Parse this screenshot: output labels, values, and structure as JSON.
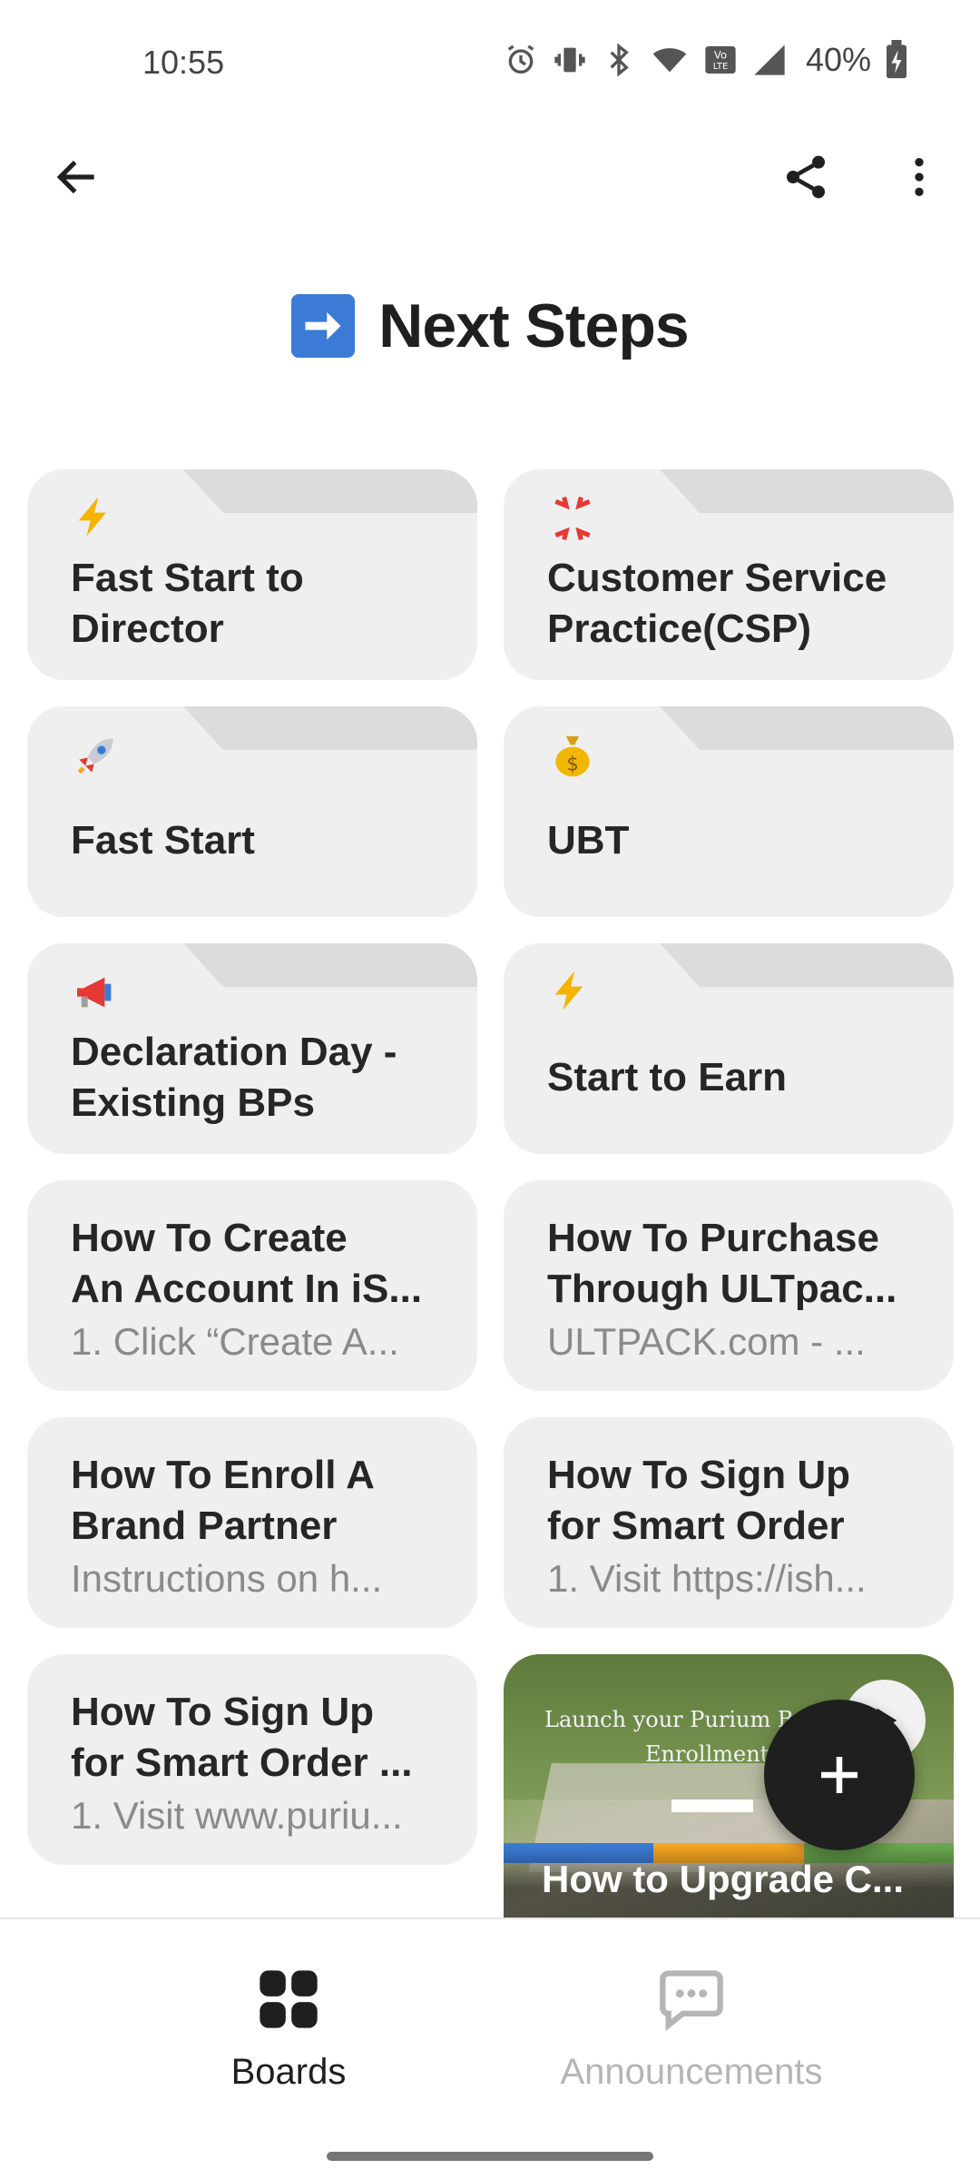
{
  "status_bar": {
    "time": "10:55",
    "battery": "40%",
    "icons": [
      "alarm-icon",
      "vibrate-icon",
      "bluetooth-icon",
      "wifi-icon",
      "volte-icon",
      "signal-icon",
      "battery-icon"
    ]
  },
  "app_bar": {
    "back_icon": "arrow-left-icon",
    "share_icon": "share-icon",
    "more_icon": "more-vertical-icon"
  },
  "page": {
    "title_emoji": "arrow-right-emoji",
    "title": "Next Steps"
  },
  "cards": [
    {
      "title": "Fast Start to Director",
      "emoji": "lightning-emoji",
      "type": "folder"
    },
    {
      "title": "Customer Service Practice(CSP)",
      "emoji": "anger-emoji",
      "type": "folder"
    },
    {
      "title": "Fast Start",
      "emoji": "rocket-emoji",
      "type": "folder"
    },
    {
      "title": "UBT",
      "emoji": "money-bag-emoji",
      "type": "folder"
    },
    {
      "title": "Declaration Day - Existing BPs",
      "emoji": "megaphone-emoji",
      "type": "folder"
    },
    {
      "title": "Start to Earn",
      "emoji": "lightning-emoji",
      "type": "folder"
    },
    {
      "title_line1": "How To Create",
      "title_line2": "An Account In iS...",
      "subtitle": "1. Click “Create A...",
      "type": "doc"
    },
    {
      "title_line1": "How To Purchase",
      "title_line2": "Through ULTpac...",
      "subtitle": "ULTPACK.com - ...",
      "type": "doc"
    },
    {
      "title_line1": "How To Enroll A",
      "title_line2": "Brand Partner",
      "subtitle": "Instructions on h...",
      "type": "doc"
    },
    {
      "title_line1": "How To Sign Up",
      "title_line2": "for Smart Order",
      "subtitle": "1. Visit https://ish...",
      "type": "doc"
    },
    {
      "title_line1": "How To Sign Up",
      "title_line2": "for Smart Order ...",
      "subtitle": "1. Visit www.puriu...",
      "type": "doc"
    }
  ],
  "video_card": {
    "image_text_line1": "Launch your Purium Busi",
    "image_text_line2": "Enrollment P",
    "caption": "How to Upgrade C...",
    "play_icon": "play-icon"
  },
  "fab": {
    "icon": "plus-icon"
  },
  "bottom_nav": {
    "boards_label": "Boards",
    "announcements_label": "Announcements",
    "active": "Boards"
  }
}
